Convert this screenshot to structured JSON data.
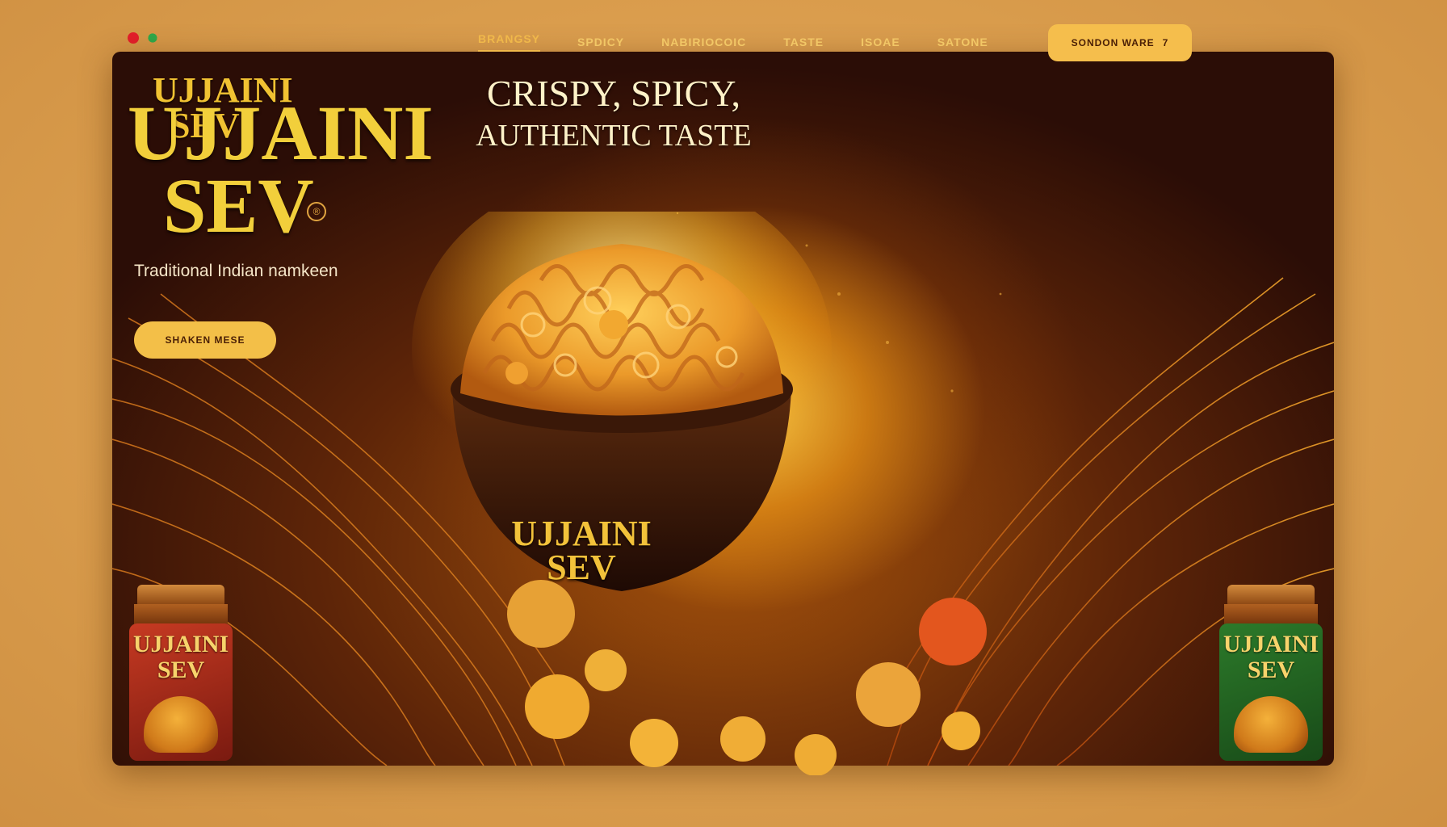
{
  "nav": {
    "items": [
      "BRANGSY",
      "SPDICY",
      "NABIRIOCOIC",
      "TASTE",
      "ISOAE",
      "SATONE"
    ],
    "active_index": 0,
    "cta": {
      "label": "SONDON WARE",
      "icon": "arrow-icon",
      "glyph": "7"
    }
  },
  "brand": {
    "logo_small_line1": "UJJAINI",
    "logo_small_line2": "SEV",
    "title_line1": "UJJAINI",
    "title_line2": "SEV",
    "reg_symbol": "®"
  },
  "hero": {
    "headline_line1": "CRISPY, SPICY,",
    "headline_line2": "AUTHENTIC TASTE",
    "tagline": "Traditional Indian namkeen",
    "button_label": "SHAKEN MESE"
  },
  "bowl": {
    "label_line1": "UJJAINI",
    "label_line2": "SEV"
  },
  "jars": [
    {
      "label_line1": "UJJAINI",
      "label_line2": "SEV",
      "color": "#c63a22"
    },
    {
      "label_line1": "UJJAINI",
      "label_line2": "SEV",
      "color": "#2c7a2a"
    }
  ],
  "colors": {
    "accent": "#f3bf48",
    "brand_gold": "#f2cf3b",
    "background_dark": "#2b0d06",
    "page_bg": "#d99c4c"
  }
}
